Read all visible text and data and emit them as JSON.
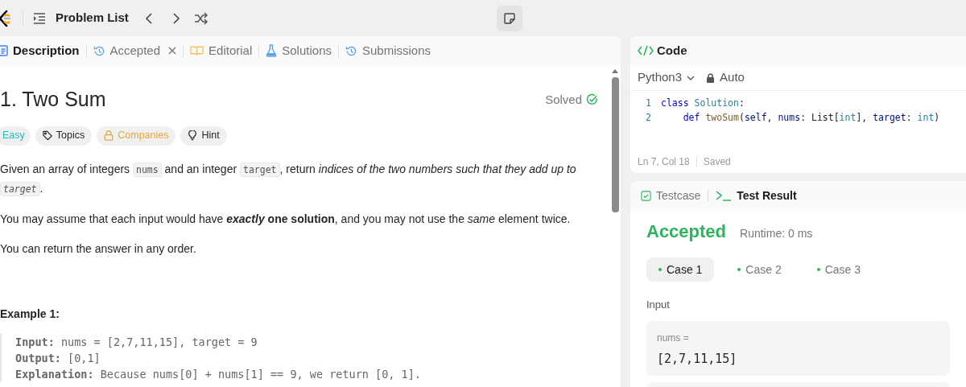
{
  "top_bar": {
    "title": "Problem List"
  },
  "tabs": [
    {
      "label": "Description",
      "selected": true,
      "kind": "doc",
      "closable": false
    },
    {
      "label": "Accepted",
      "selected": false,
      "kind": "history",
      "closable": true
    },
    {
      "label": "Editorial",
      "selected": false,
      "kind": "book",
      "closable": false
    },
    {
      "label": "Solutions",
      "selected": false,
      "kind": "flask",
      "closable": false
    },
    {
      "label": "Submissions",
      "selected": false,
      "kind": "history",
      "closable": false
    }
  ],
  "problem": {
    "title": "1. Two Sum",
    "status": "Solved",
    "tags": [
      {
        "label": "Easy",
        "kind": "difficulty"
      },
      {
        "label": "Topics",
        "kind": "tag"
      },
      {
        "label": "Companies",
        "kind": "lock"
      },
      {
        "label": "Hint",
        "kind": "bulb"
      }
    ],
    "paragraphs": [
      [
        {
          "kind": "text",
          "text": "Given an array of integers "
        },
        {
          "kind": "code",
          "text": "nums"
        },
        {
          "kind": "text",
          "text": " and an integer "
        },
        {
          "kind": "code",
          "text": "target"
        },
        {
          "kind": "text",
          "text": ", return *indices of the two numbers such that they add up to* "
        },
        {
          "kind": "code_italic",
          "text": "target"
        },
        {
          "kind": "text",
          "text": "."
        }
      ],
      [
        {
          "kind": "text",
          "text": "You may assume that each input would have "
        },
        {
          "kind": "bold_italic",
          "text": "exactly"
        },
        {
          "kind": "text",
          "text": " **one solution**, and you may not use the *same* element twice."
        }
      ],
      [
        {
          "kind": "text",
          "text": "You can return the answer in any order."
        }
      ]
    ],
    "example_title": "Example 1:",
    "example_lines": [
      "**Input:** nums = [2,7,11,15], target = 9",
      "**Output:** [0,1]",
      "**Explanation:** Because nums[0] + nums[1] == 9, we return [0, 1]."
    ]
  },
  "code_panel": {
    "title": "Code",
    "language": "Python3",
    "mode": "Auto",
    "lines": [
      {
        "number": "1",
        "tokens": [
          {
            "kind": "kw",
            "text": "class"
          },
          {
            "kind": "type",
            "text": " Solution"
          },
          {
            "kind": "plain",
            "text": ":"
          }
        ]
      },
      {
        "number": "2",
        "tokens": [
          {
            "kind": "kw",
            "text": "    def"
          },
          {
            "kind": "fn",
            "text": " twoSum"
          },
          {
            "kind": "plain",
            "text": "("
          },
          {
            "kind": "var",
            "text": "self"
          },
          {
            "kind": "plain",
            "text": ", "
          },
          {
            "kind": "var",
            "text": "nums"
          },
          {
            "kind": "plain",
            "text": ": List["
          },
          {
            "kind": "type",
            "text": "int"
          },
          {
            "kind": "plain",
            "text": "], "
          },
          {
            "kind": "var",
            "text": "target"
          },
          {
            "kind": "plain",
            "text": ": "
          },
          {
            "kind": "type",
            "text": "int"
          },
          {
            "kind": "plain",
            "text": ")"
          }
        ]
      }
    ],
    "position": "Ln 7, Col 18",
    "save_state": "Saved"
  },
  "result_panel": {
    "tabs": [
      {
        "label": "Testcase",
        "selected": false,
        "kind": "check"
      },
      {
        "label": "Test Result",
        "selected": true,
        "kind": "terminal"
      }
    ],
    "verdict": "Accepted",
    "runtime": "Runtime: 0 ms",
    "cases": [
      {
        "label": "Case 1",
        "selected": true
      },
      {
        "label": "Case 2",
        "selected": false
      },
      {
        "label": "Case 3",
        "selected": false
      }
    ],
    "input_label": "Input",
    "param_name": "nums =",
    "param_value": "[2,7,11,15]"
  }
}
